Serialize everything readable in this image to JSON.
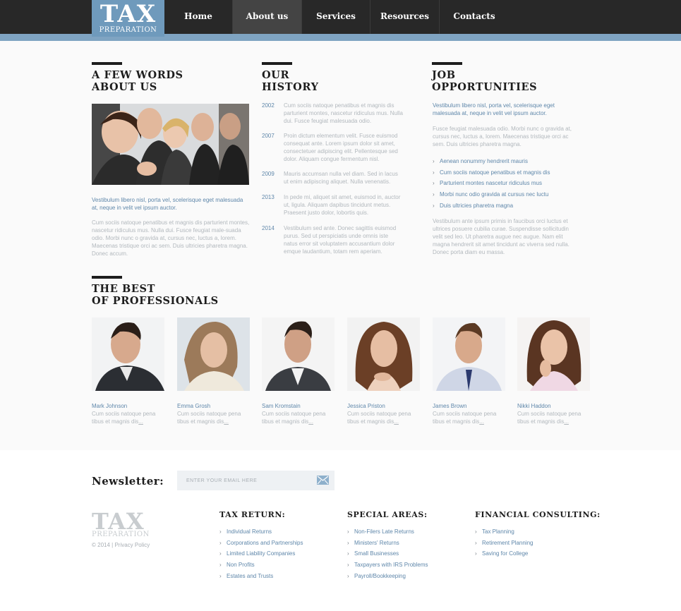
{
  "logo": {
    "line1": "TAX",
    "line2": "PREPARATION"
  },
  "nav": [
    {
      "label": "Home",
      "active": false
    },
    {
      "label": "About us",
      "active": true
    },
    {
      "label": "Services",
      "active": false
    },
    {
      "label": "Resources",
      "active": false
    },
    {
      "label": "Contacts",
      "active": false
    }
  ],
  "colors": {
    "accent": "#6f9abc",
    "topbar": "#282828",
    "link": "#5f87aa"
  },
  "about": {
    "title_line1": "A FEW WORDS",
    "title_line2": "ABOUT US",
    "lead": "Vestibulum libero nisl, porta vel, scelerisque eget malesuada at, neque in velit vel ipsum auctor.",
    "text": "Cum sociis natoque penatibus et magnis dis parturient montes, nascetur ridiculus mus. Nulla dui. Fusce feugiat male-suada odio. Morbi nunc o gravida at, cursus nec, luctus a, lorem. Maecenas tristique orci ac sem. Duis ultricies pharetra magna. Donec accum."
  },
  "history": {
    "title_line1": "OUR",
    "title_line2": "HISTORY",
    "entries": [
      {
        "year": "2002",
        "text": "Cum sociis natoque penatibus et magnis dis parturient montes, nascetur ridiculus mus. Nulla dui. Fusce feugiat malesuada odio."
      },
      {
        "year": "2007",
        "text": "Proin dictum elementum velit. Fusce euismod consequat ante. Lorem ipsum dolor sit amet, consectetuer adipiscing elit. Pellentesque sed dolor. Aliquam congue fermentum nisl."
      },
      {
        "year": "2009",
        "text": "Mauris accumsan nulla vel diam. Sed in lacus ut enim adipiscing aliquet. Nulla venenatis."
      },
      {
        "year": "2013",
        "text": "In pede mi, aliquet sit amet, euismod in, auctor ut, ligula. Aliquam dapibus tincidunt metus. Praesent justo dolor, lobortis quis."
      },
      {
        "year": "2014",
        "text": "Vestibulum sed ante. Donec sagittis euismod purus. Sed ut perspiciatis unde omnis iste natus error sit voluptatem accusantium dolor emque laudantium, totam rem aperiam."
      }
    ]
  },
  "jobs": {
    "title_line1": "JOB",
    "title_line2": "OPPORTUNITIES",
    "lead": "Vestibulum libero nisl, porta vel, scelerisque eget malesuada at, neque in velit vel ipsum auctor.",
    "text1": "Fusce feugiat malesuada odio. Morbi nunc o gravida at, cursus nec, luctus a, lorem. Maecenas tristique orci ac sem. Duis ultricies pharetra magna.",
    "items": [
      "Aenean nonummy hendrerit mauris",
      "Cum sociis natoque penatibus et magnis dis",
      "Parturient montes nascetur ridiculus mus",
      "Morbi nunc odio gravida at cursus nec luctu",
      "Duis ultricies pharetra magna"
    ],
    "text2": "Vestibulum ante ipsum primis in faucibus orci luctus et ultrices posuere cubilia curae. Suspendisse sollicitudin velit sed leo. Ut pharetra augue nec augue. Nam elit magna hendrerit sit amet tincidunt ac viverra sed nulla. Donec porta diam eu massa."
  },
  "team": {
    "title_line1": "THE BEST",
    "title_line2": "OF PROFESSIONALS",
    "members": [
      {
        "name": "Mark Johnson",
        "desc": "Cum sociis natoque pena tibus et magnis dis",
        "more": "..."
      },
      {
        "name": "Emma Grosh",
        "desc": "Cum sociis natoque pena tibus et magnis dis",
        "more": "..."
      },
      {
        "name": "Sam Kromstain",
        "desc": "Cum sociis natoque pena tibus et magnis dis",
        "more": "..."
      },
      {
        "name": "Jessica Priston",
        "desc": "Cum sociis natoque pena tibus et magnis dis",
        "more": "..."
      },
      {
        "name": "James Brown",
        "desc": "Cum sociis natoque pena tibus et magnis dis",
        "more": "..."
      },
      {
        "name": "Nikki Haddon",
        "desc": "Cum sociis natoque pena tibus et magnis dis",
        "more": "..."
      }
    ]
  },
  "newsletter": {
    "label": "Newsletter:",
    "placeholder": "ENTER YOUR EMAIL HERE",
    "icon": "envelope-icon"
  },
  "footer": {
    "logo_line1": "TAX",
    "logo_line2": "PREPARATION",
    "copyright": "© 2014 | Privacy Policy",
    "columns": [
      {
        "title": "TAX RETURN:",
        "items": [
          "Individual Returns",
          "Corporations and Partnerships",
          "Limited Liability Companies",
          "Non Profits",
          "Estates and Trusts"
        ]
      },
      {
        "title": "SPECIAL AREAS:",
        "items": [
          "Non-Filers Late Returns",
          "Ministers' Returns",
          "Small Businesses",
          "Taxpayers with IRS Problems",
          "Payroll/Bookkeeping"
        ]
      },
      {
        "title": "FINANCIAL CONSULTING:",
        "items": [
          "Tax Planning",
          "Retirement Planning",
          "Saving for College"
        ]
      }
    ]
  }
}
